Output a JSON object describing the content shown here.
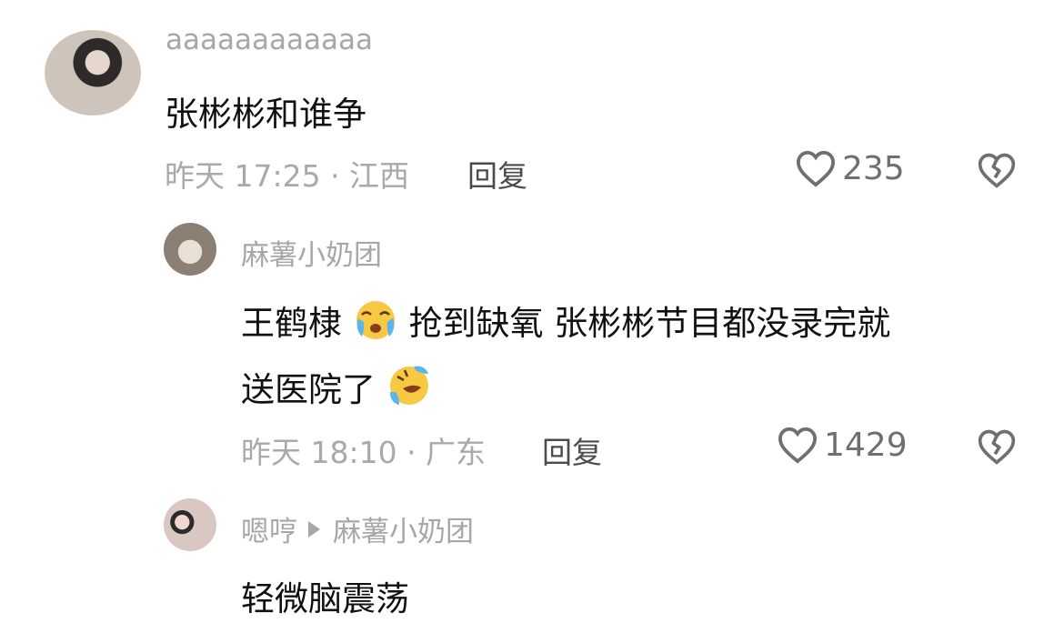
{
  "comments": [
    {
      "username": "aaaaaaaaaaaa",
      "text": "张彬彬和谁争",
      "meta": "昨天 17:25 · 江西",
      "reply_label": "回复",
      "likes": "235"
    },
    {
      "username": "麻薯小奶团",
      "text_line1_a": "王鹤棣",
      "text_line1_b": " 抢到缺氧 张彬彬节目都没录完就",
      "text_line2": "送医院了",
      "meta": "昨天 18:10 · 广东",
      "reply_label": "回复",
      "likes": "1429"
    },
    {
      "username": "嗯哼",
      "reply_to": "麻薯小奶团",
      "text": "轻微脑震荡"
    }
  ],
  "icons": {
    "like": "heart-outline-icon",
    "dislike": "broken-heart-icon",
    "emoji1": "crying-face-emoji",
    "emoji2": "rolling-laughing-emoji",
    "reply_arrow": "play-arrow-icon"
  },
  "colors": {
    "username": "#a7a7a7",
    "text": "#111111",
    "meta": "#a9a9a9",
    "reply": "#4b4b4b",
    "icon": "#6f6f6f"
  }
}
